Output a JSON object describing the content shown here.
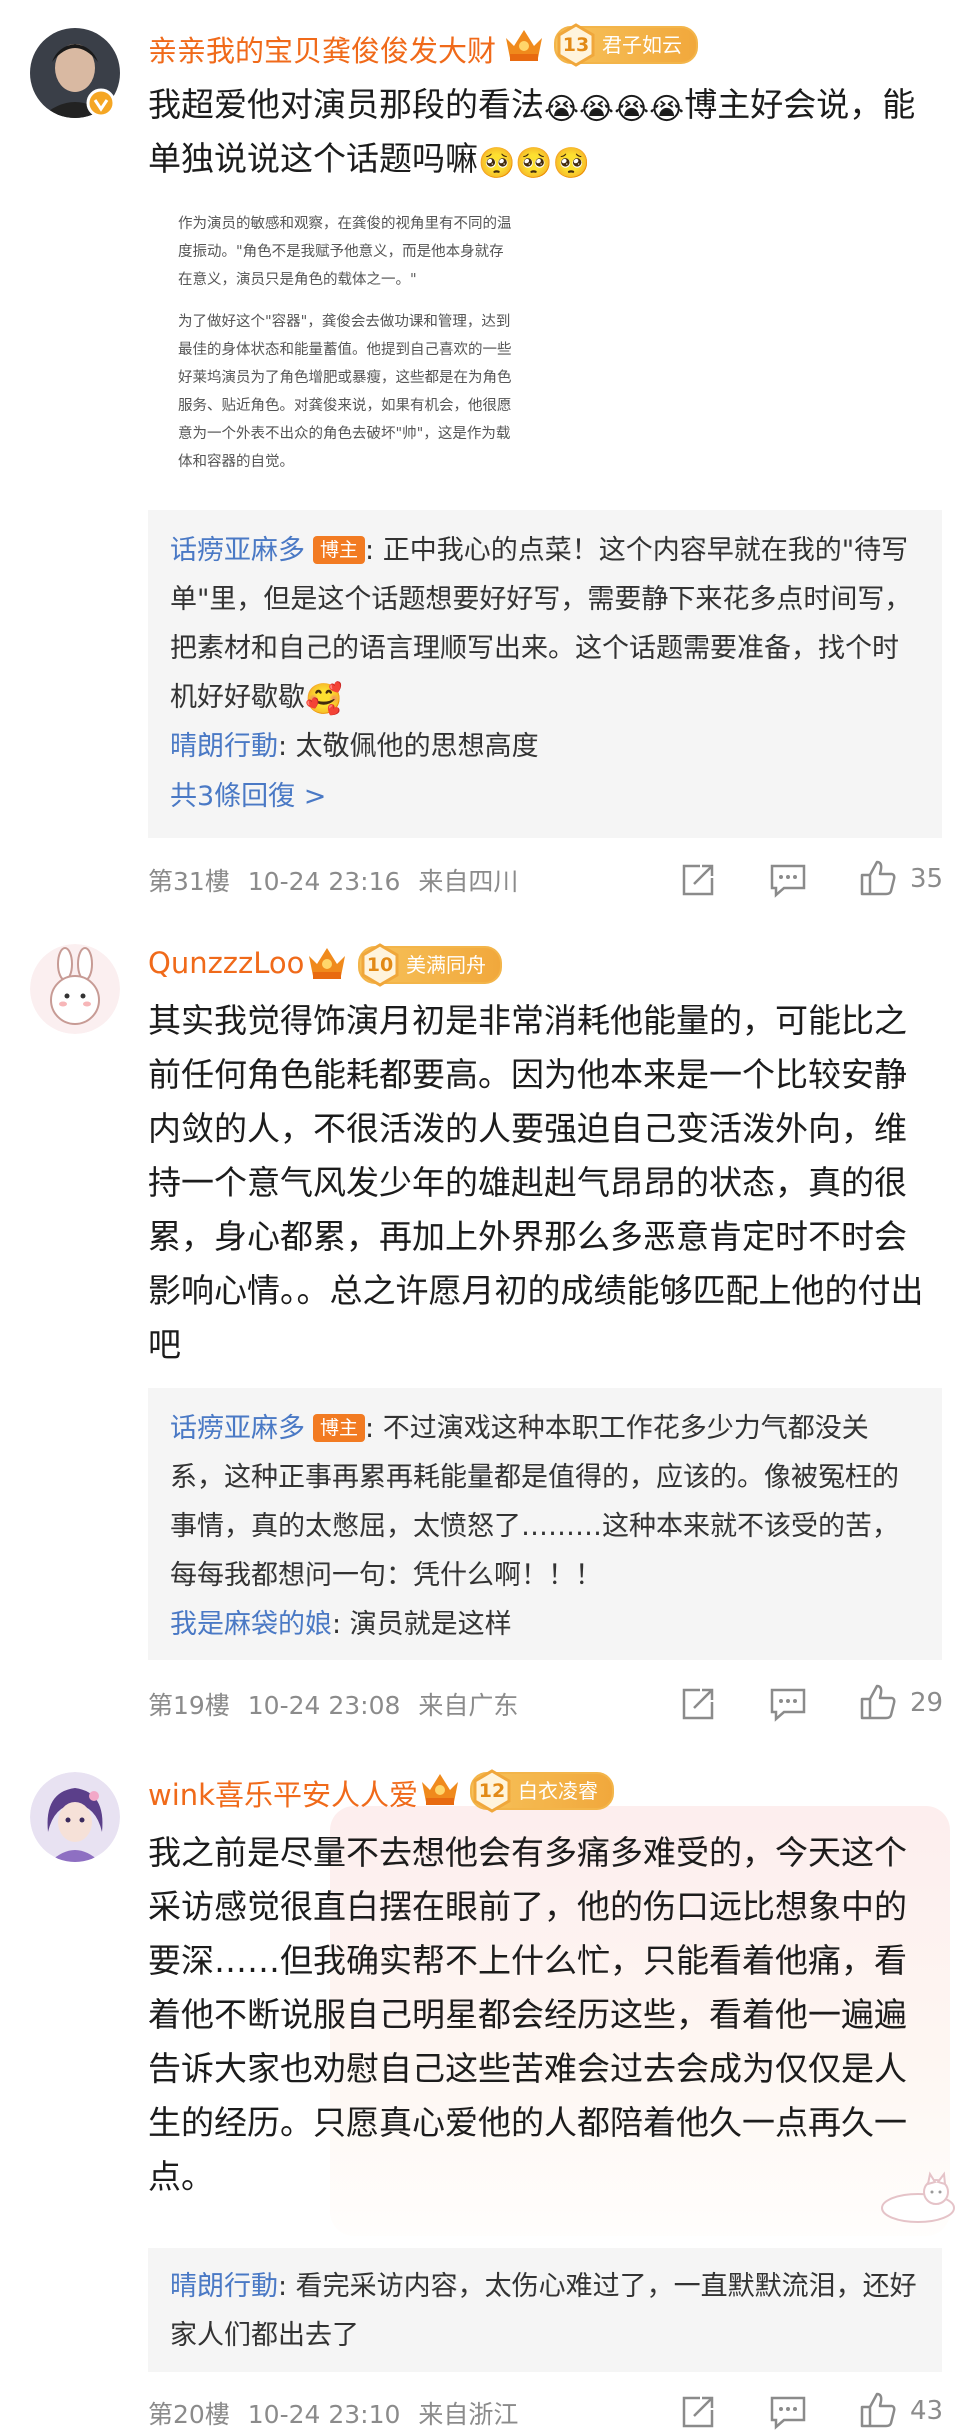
{
  "comments": [
    {
      "username": "亲亲我的宝贝龚俊俊发大财",
      "level": "13",
      "level_title": "君子如云",
      "text_line1": "我超爱他对演员那段的看法",
      "text_emoji1": "😭😭😭😭",
      "text_line1b": "博主好会说，能",
      "text_line2": "单独说说这个话题吗嘛",
      "text_emoji2": "🥺🥺🥺",
      "excerpt": {
        "p1": "作为演员的敏感和观察，在龚俊的视角里有不同的温度振动。\"角色不是我赋予他意义，而是他本身就存在意义，演员只是角色的载体之一。\"",
        "p2": "为了做好这个\"容器\"，龚俊会去做功课和管理，达到最佳的身体状态和能量蓄值。他提到自己喜欢的一些好莱坞演员为了角色增肥或暴瘦，这些都是在为角色服务、贴近角色。对龚俊来说，如果有机会，他很愿意为一个外表不出众的角色去破坏\"帅\"，这是作为载体和容器的自觉。"
      },
      "replies": [
        {
          "name": "话痨亚麻多",
          "badge": "博主",
          "text": ": 正中我心的点菜！这个内容早就在我的\"待写单\"里，但是这个话题想要好好写，需要静下来花多点时间写，把素材和自己的语言理顺写出来。这个话题需要准备，找个时机好好歇歇",
          "emoji": "🥰"
        },
        {
          "name": "晴朗行動",
          "text": ": 太敬佩他的思想高度"
        }
      ],
      "more_replies": "共3條回復 >",
      "floor": "第31樓",
      "time": "10-24 23:16",
      "location": "来自四川",
      "likes": "35"
    },
    {
      "username": "QunzzzLoo",
      "level": "10",
      "level_title": "美满同舟",
      "text": "其实我觉得饰演月初是非常消耗他能量的，可能比之前任何角色能耗都要高。因为他本来是一个比较安静内敛的人，不很活泼的人要强迫自己变活泼外向，维持一个意气风发少年的雄赳赳气昂昂的状态，真的很累，身心都累，再加上外界那么多恶意肯定时不时会影响心情。。总之许愿月初的成绩能够匹配上他的付出吧",
      "replies": [
        {
          "name": "话痨亚麻多",
          "badge": "博主",
          "text": ": 不过演戏这种本职工作花多少力气都没关系，这种正事再累再耗能量都是值得的，应该的。像被冤枉的事情，真的太憋屈，太愤怒了………这种本来就不该受的苦，每每我都想问一句：凭什么啊！！！"
        },
        {
          "name": "我是麻袋的娘",
          "text": ": 演员就是这样"
        }
      ],
      "floor": "第19樓",
      "time": "10-24 23:08",
      "location": "来自广东",
      "likes": "29"
    },
    {
      "username": "wink喜乐平安人人爱",
      "level": "12",
      "level_title": "白衣凌睿",
      "text": "我之前是尽量不去想他会有多痛多难受的，今天这个采访感觉很直白摆在眼前了，他的伤口远比想象中的要深……但我确实帮不上什么忙，只能看着他痛，看着他不断说服自己明星都会经历这些，看着他一遍遍告诉大家也劝慰自己这些苦难会过去会成为仅仅是人生的经历。只愿真心爱他的人都陪着他久一点再久一点。",
      "replies": [
        {
          "name": "晴朗行動",
          "text": ": 看完采访内容，太伤心难过了，一直默默流泪，还好家人们都出去了"
        }
      ],
      "floor": "第20樓",
      "time": "10-24 23:10",
      "location": "来自浙江",
      "likes": "43"
    }
  ],
  "icons": [
    "repost-icon",
    "comment-icon",
    "like-icon",
    "vip-crown-icon",
    "verified-badge-icon"
  ],
  "colors": {
    "username": "#f06a1a",
    "reply_name": "#4a79c5",
    "badge": "#f27b22",
    "meta": "#8b8b8b",
    "reply_bg": "#f5f5f5"
  }
}
